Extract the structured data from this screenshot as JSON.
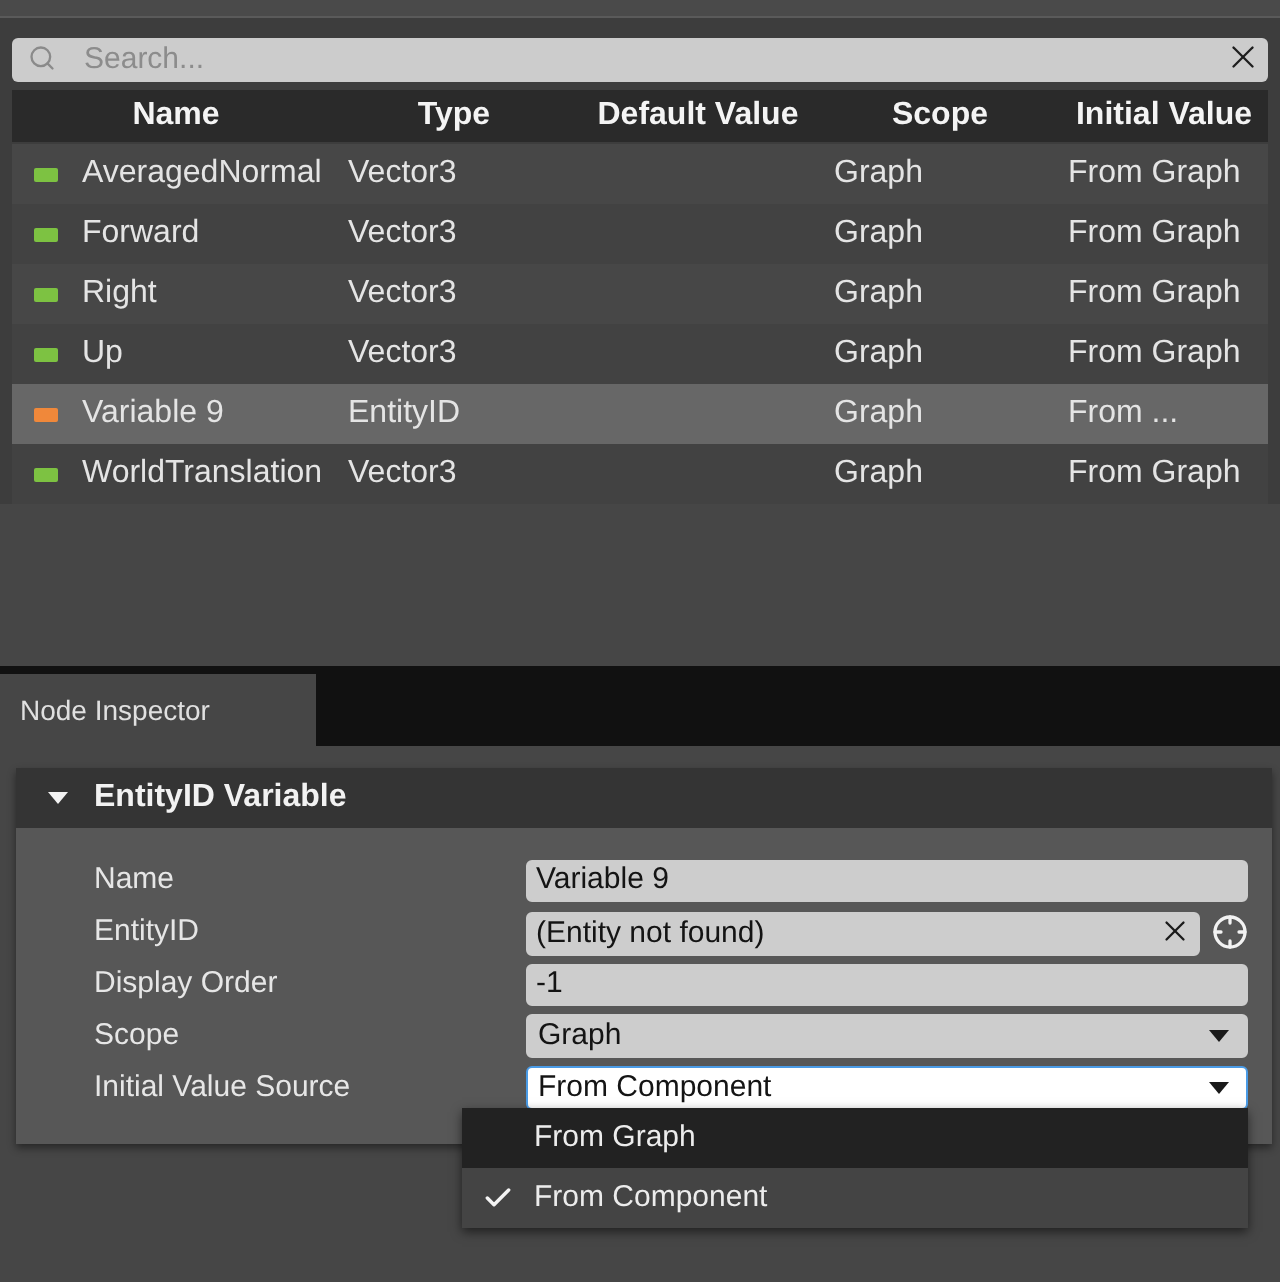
{
  "search": {
    "placeholder": "Search..."
  },
  "table": {
    "columns": [
      "Name",
      "Type",
      "Default Value",
      "Scope",
      "Initial Value"
    ],
    "rows": [
      {
        "name": "AveragedNormal",
        "color": "#7dc242",
        "type": "Vector3",
        "scope": "Graph",
        "initial_value": "From Graph",
        "selected": false
      },
      {
        "name": "Forward",
        "color": "#7dc242",
        "type": "Vector3",
        "scope": "Graph",
        "initial_value": "From Graph",
        "selected": false
      },
      {
        "name": "Right",
        "color": "#7dc242",
        "type": "Vector3",
        "scope": "Graph",
        "initial_value": "From Graph",
        "selected": false
      },
      {
        "name": "Up",
        "color": "#7dc242",
        "type": "Vector3",
        "scope": "Graph",
        "initial_value": "From Graph",
        "selected": false
      },
      {
        "name": "Variable 9",
        "color": "#f0883a",
        "type": "EntityID",
        "scope": "Graph",
        "initial_value": "From ...",
        "selected": true
      },
      {
        "name": "WorldTranslation",
        "color": "#7dc242",
        "type": "Vector3",
        "scope": "Graph",
        "initial_value": "From Graph",
        "selected": false
      }
    ]
  },
  "panel_tabs": [
    {
      "label": "Node Inspector",
      "selected": true
    }
  ],
  "inspector": {
    "title": "EntityID Variable",
    "expanded": true,
    "properties": [
      {
        "kind": "text",
        "label": "Name",
        "value": "Variable 9",
        "focused": false
      },
      {
        "kind": "entity",
        "label": "EntityID",
        "value": "(Entity not found)",
        "focused": false
      },
      {
        "kind": "text",
        "label": "Display Order",
        "value": "-1",
        "focused": false
      },
      {
        "kind": "dropdown",
        "label": "Scope",
        "value": "Graph",
        "focused": false
      },
      {
        "kind": "dropdown",
        "label": "Initial Value Source",
        "value": "From Component",
        "focused": true
      }
    ]
  },
  "dropdown_menu": {
    "options": [
      {
        "label": "From Graph",
        "highlighted": true,
        "checked": false
      },
      {
        "label": "From Component",
        "highlighted": false,
        "checked": true
      }
    ]
  }
}
